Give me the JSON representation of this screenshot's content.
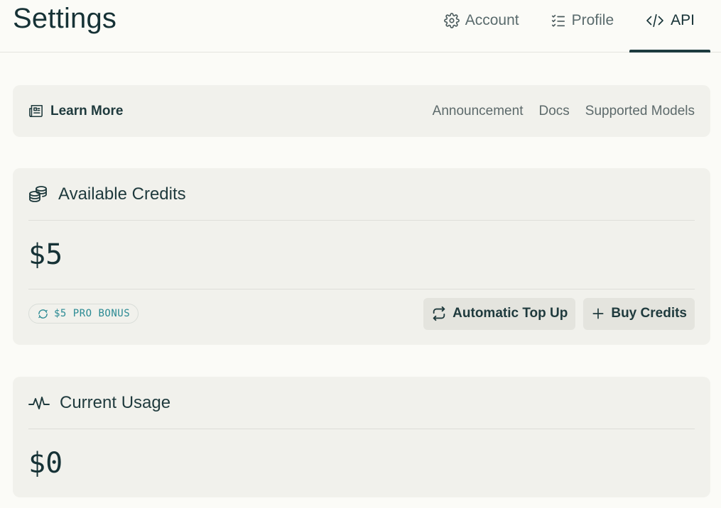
{
  "header": {
    "title": "Settings",
    "tabs": [
      {
        "label": "Account",
        "icon": "gear-icon"
      },
      {
        "label": "Profile",
        "icon": "checklist-icon"
      },
      {
        "label": "API",
        "icon": "code-icon",
        "active": true
      }
    ]
  },
  "learn_more": {
    "label": "Learn More",
    "icon": "newspaper-icon",
    "links": [
      "Announcement",
      "Docs",
      "Supported Models"
    ]
  },
  "credits": {
    "title": "Available Credits",
    "icon": "coins-icon",
    "amount": "$5",
    "bonus_badge": "$5 PRO BONUS",
    "buttons": {
      "top_up": "Automatic Top Up",
      "buy": "Buy Credits"
    }
  },
  "usage": {
    "title": "Current Usage",
    "icon": "activity-icon",
    "amount": "$0"
  },
  "colors": {
    "background": "#fbfbf7",
    "card": "#f1f1ec",
    "text": "#1f3a3d",
    "accent_teal": "#2a8a93"
  }
}
